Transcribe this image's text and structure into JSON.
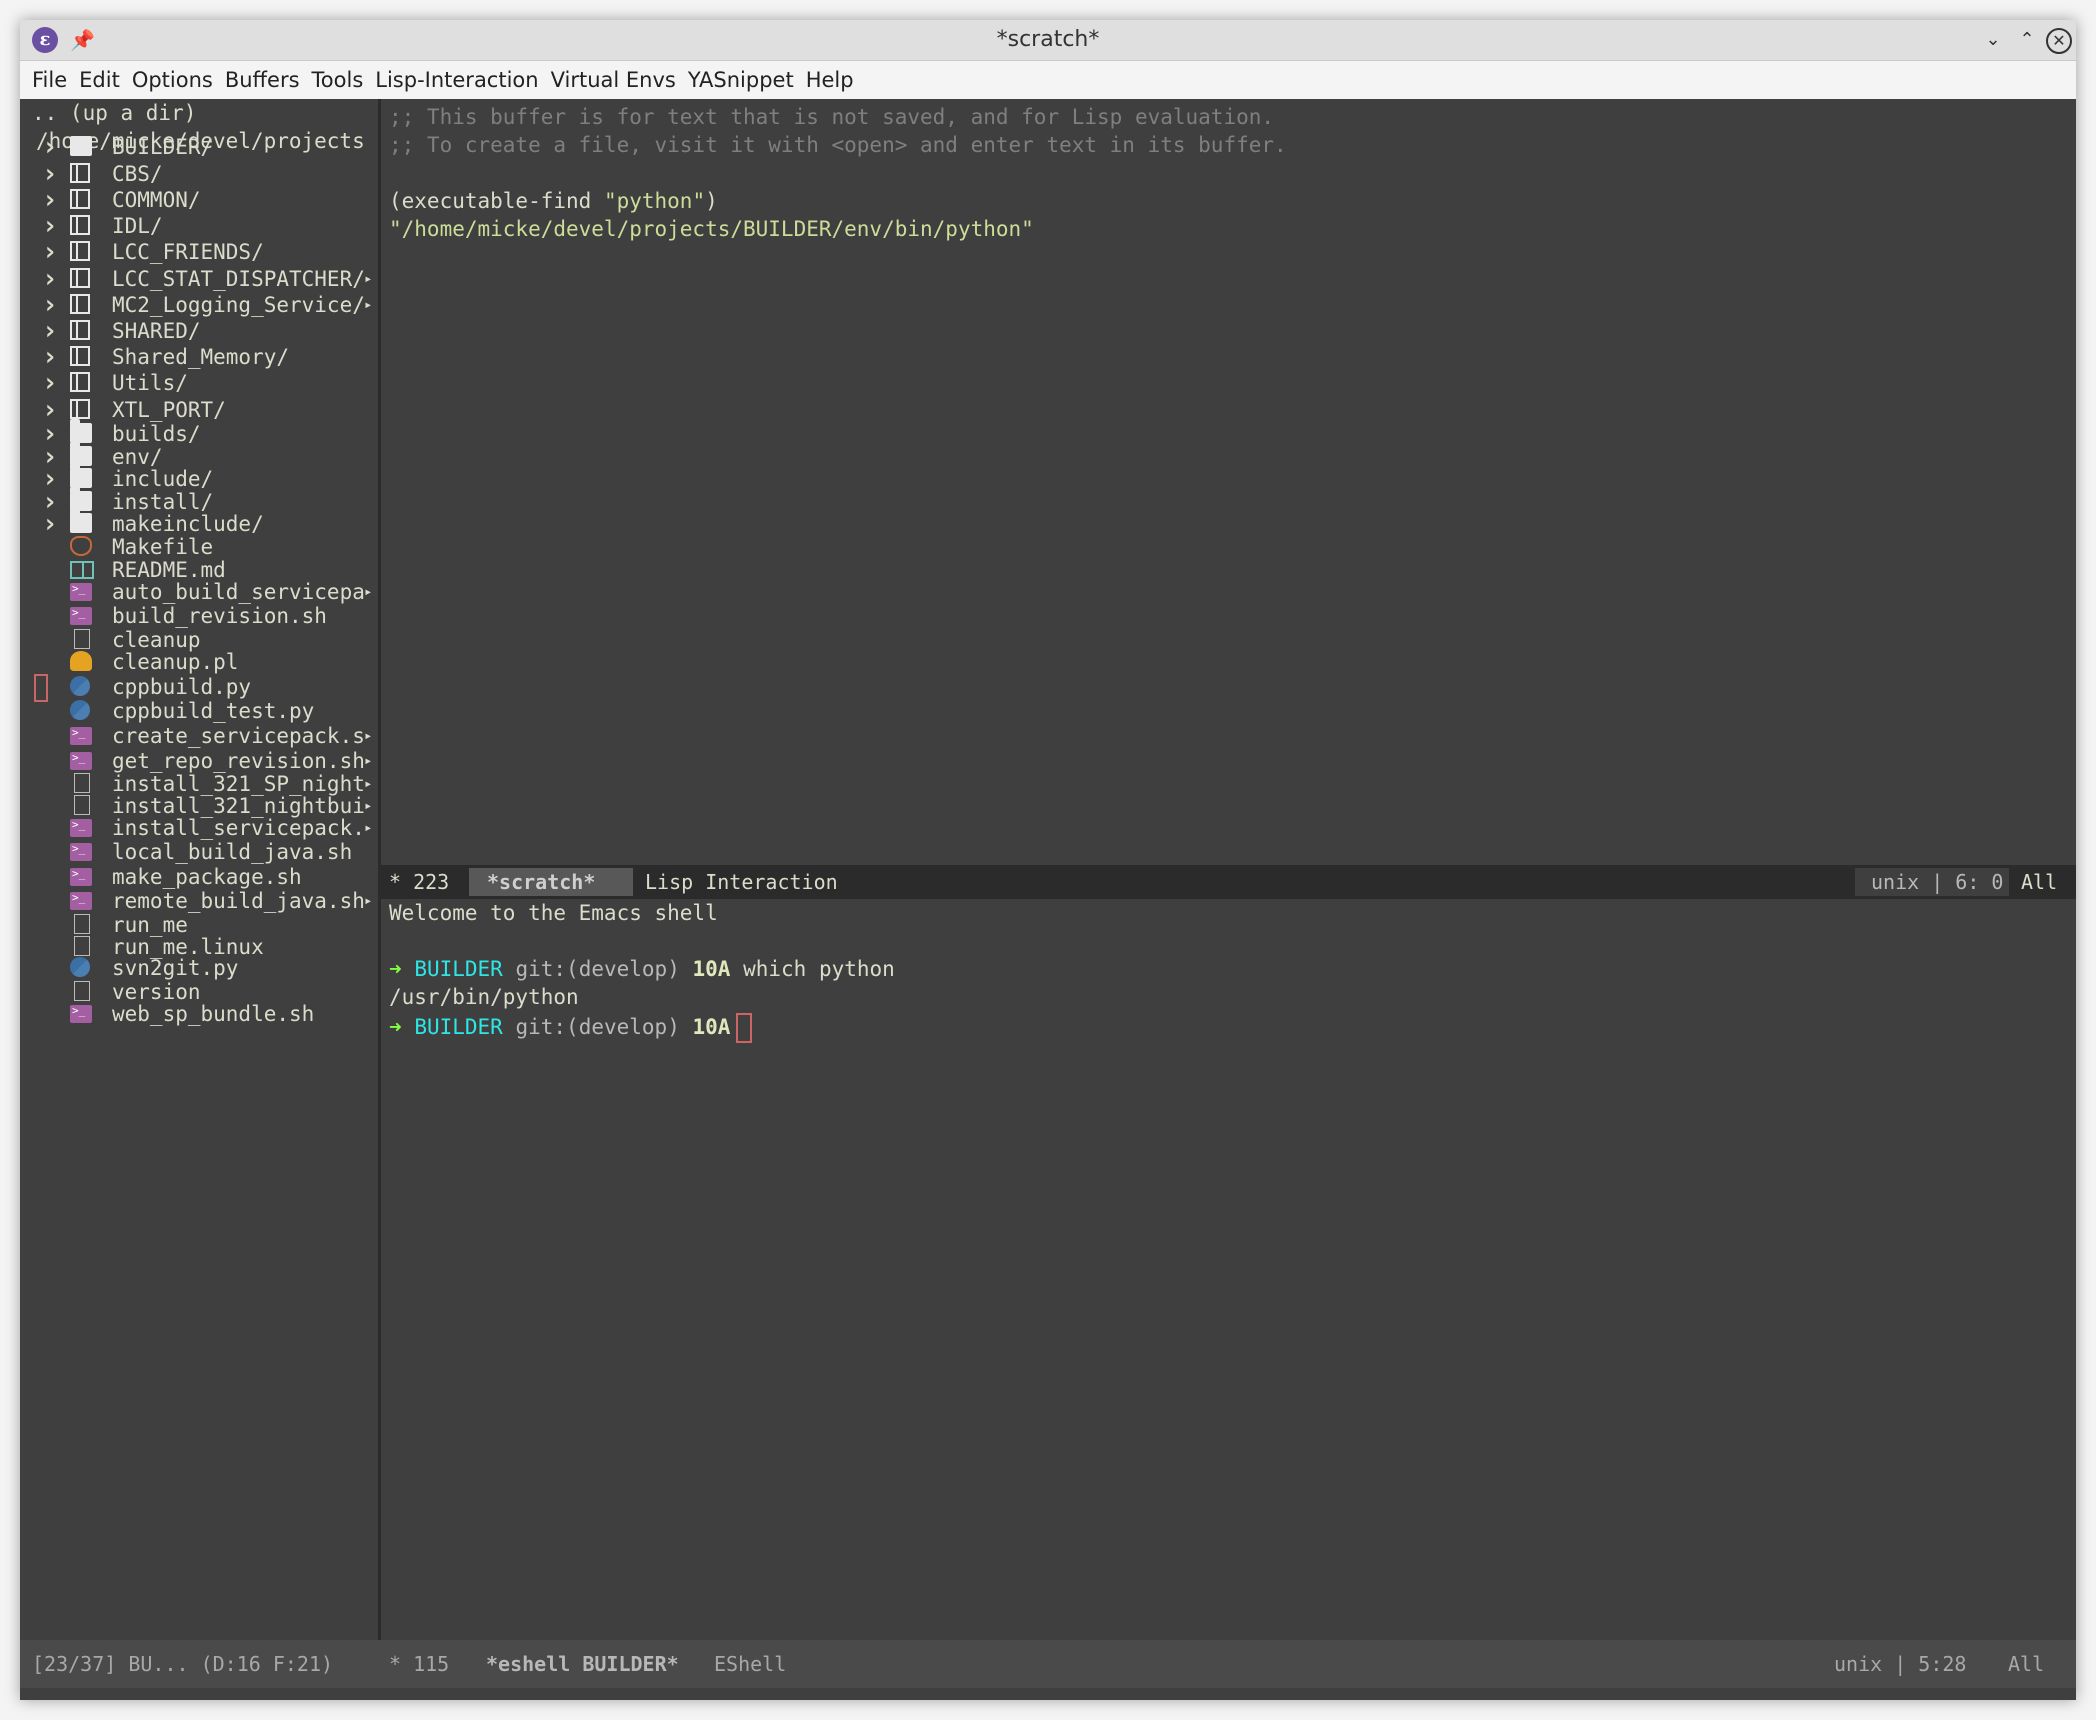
{
  "window": {
    "title": "*scratch*",
    "app_icon": "emacs-icon",
    "pin_icon": "pin-icon",
    "controls": {
      "minimize": "⌄",
      "maximize": "⌃",
      "close": "✕"
    }
  },
  "menu": [
    "File",
    "Edit",
    "Options",
    "Buffers",
    "Tools",
    "Lisp-Interaction",
    "Virtual Envs",
    "YASnippet",
    "Help"
  ],
  "sidebar": {
    "up_dir": ".. (up a dir)",
    "path": "/home/micke/devel/projects",
    "items": [
      {
        "name": "BUILDER/",
        "icon": "export-folder",
        "expandable": true
      },
      {
        "name": "CBS/",
        "icon": "repo",
        "expandable": true
      },
      {
        "name": "COMMON/",
        "icon": "repo",
        "expandable": true
      },
      {
        "name": "IDL/",
        "icon": "repo",
        "expandable": true
      },
      {
        "name": "LCC_FRIENDS/",
        "icon": "repo",
        "expandable": true
      },
      {
        "name": "LCC_STAT_DISPATCHER/",
        "icon": "repo",
        "expandable": true,
        "truncated": true
      },
      {
        "name": "MC2_Logging_Service/",
        "icon": "repo",
        "expandable": true,
        "truncated": true
      },
      {
        "name": "SHARED/",
        "icon": "repo",
        "expandable": true
      },
      {
        "name": "Shared_Memory/",
        "icon": "repo",
        "expandable": true
      },
      {
        "name": "Utils/",
        "icon": "repo",
        "expandable": true
      },
      {
        "name": "XTL_PORT/",
        "icon": "repo",
        "expandable": true
      },
      {
        "name": "builds/",
        "icon": "folder",
        "expandable": true
      },
      {
        "name": "env/",
        "icon": "folder",
        "expandable": true
      },
      {
        "name": "include/",
        "icon": "folder",
        "expandable": true
      },
      {
        "name": "install/",
        "icon": "folder",
        "expandable": true
      },
      {
        "name": "makeinclude/",
        "icon": "folder",
        "expandable": true
      },
      {
        "name": "Makefile",
        "icon": "makefile"
      },
      {
        "name": "README.md",
        "icon": "markdown"
      },
      {
        "name": "auto_build_servicepa",
        "icon": "shell",
        "truncated": true
      },
      {
        "name": "build_revision.sh",
        "icon": "shell"
      },
      {
        "name": "cleanup",
        "icon": "file"
      },
      {
        "name": "cleanup.pl",
        "icon": "perl"
      },
      {
        "name": "cppbuild.py",
        "icon": "python",
        "marked": true
      },
      {
        "name": "cppbuild_test.py",
        "icon": "python"
      },
      {
        "name": "create_servicepack.s",
        "icon": "shell",
        "truncated": true
      },
      {
        "name": "get_repo_revision.sh",
        "icon": "shell",
        "truncated": true
      },
      {
        "name": "install_321_SP_night",
        "icon": "file",
        "truncated": true
      },
      {
        "name": "install_321_nightbui",
        "icon": "file",
        "truncated": true
      },
      {
        "name": "install_servicepack.",
        "icon": "shell",
        "truncated": true
      },
      {
        "name": "local_build_java.sh",
        "icon": "shell"
      },
      {
        "name": "make_package.sh",
        "icon": "shell"
      },
      {
        "name": "remote_build_java.sh",
        "icon": "shell",
        "truncated": true
      },
      {
        "name": "run_me",
        "icon": "file"
      },
      {
        "name": "run_me.linux",
        "icon": "file"
      },
      {
        "name": "svn2git.py",
        "icon": "python"
      },
      {
        "name": "version",
        "icon": "file"
      },
      {
        "name": "web_sp_bundle.sh",
        "icon": "shell"
      }
    ]
  },
  "editor": {
    "comment1": ";; This buffer is for text that is not saved, and for Lisp evaluation.",
    "comment2": ";; To create a file, visit it with <open> and enter text in its buffer.",
    "code_prefix": "(executable-find ",
    "code_arg": "\"python\"",
    "code_suffix": ")",
    "result": "\"/home/micke/devel/projects/BUILDER/env/bin/python\""
  },
  "modeline_upper": {
    "size": "* 223",
    "buffer": "*scratch*",
    "mode": "Lisp Interaction",
    "encoding": "unix | 6: 0",
    "position": "All"
  },
  "shell": {
    "welcome": "Welcome to the Emacs shell",
    "prompt_arrow": "➜",
    "prompt_dir": "BUILDER",
    "prompt_git": "git:(develop)",
    "prompt_time": "10A",
    "command": "which python",
    "output": "/usr/bin/python"
  },
  "modeline_bottom": {
    "sidebar_status": "[23/37] BU... (D:16 F:21)",
    "size": "* 115",
    "buffer": "*eshell BUILDER*",
    "mode": "EShell",
    "encoding": "unix | 5:28",
    "position": "All"
  }
}
